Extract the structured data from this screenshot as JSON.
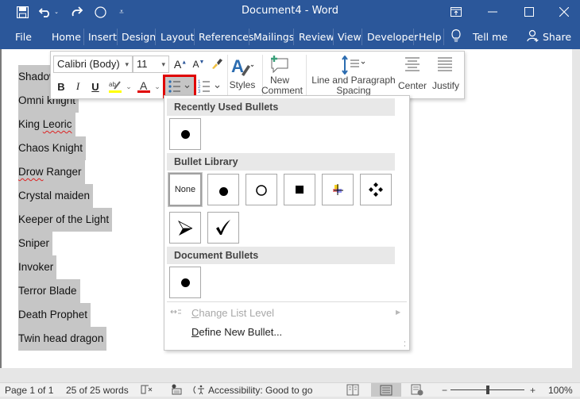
{
  "titlebar": {
    "title": "Document4  -  Word",
    "quick_access": [
      "save-icon",
      "undo-icon",
      "redo-icon",
      "touch-mode-icon",
      "customize-icon"
    ],
    "window_controls": [
      "ribbon-display-icon",
      "minimize-icon",
      "maximize-icon",
      "close-icon"
    ]
  },
  "ribbon_tabs": [
    {
      "label": "File"
    },
    {
      "label": "Home"
    },
    {
      "label": "Insert"
    },
    {
      "label": "Design"
    },
    {
      "label": "Layout"
    },
    {
      "label": "References"
    },
    {
      "label": "Mailings"
    },
    {
      "label": "Review"
    },
    {
      "label": "View"
    },
    {
      "label": "Developer"
    },
    {
      "label": "Help"
    }
  ],
  "tell_me": "Tell me",
  "share": "Share",
  "document": {
    "lines": [
      "Shadow",
      "Omni knight",
      "King Leoric",
      "Chaos Knight",
      "Drow Ranger",
      "Crystal maiden",
      "Keeper of the Light",
      "Sniper",
      "Invoker",
      "Terror Blade",
      "Death Prophet",
      "Twin head dragon"
    ],
    "misspelled": [
      "Leoric",
      "Drow"
    ]
  },
  "mini_toolbar": {
    "font_name": "Calibri (Body)",
    "font_size": "11",
    "bold": "B",
    "italic": "I",
    "underline": "U",
    "font_color_letter": "A",
    "highlight_color": "#ffff00",
    "font_color": "#e00000",
    "styles_label": "Styles",
    "new_comment_label_1": "New",
    "new_comment_label_2": "Comment",
    "spacing_label_1": "Line and Paragraph",
    "spacing_label_2": "Spacing",
    "center_label": "Center",
    "justify_label": "Justify"
  },
  "bullet_dropdown": {
    "recently_used_header": "Recently Used Bullets",
    "library_header": "Bullet Library",
    "none_label": "None",
    "library_items": [
      "none",
      "filled-circle",
      "hollow-circle",
      "filled-square",
      "four-diamond-cross",
      "diamond-cluster",
      "arrowhead",
      "checkmark"
    ],
    "document_header": "Document Bullets",
    "change_level": "Change List Level",
    "define_new": "Define New Bullet..."
  },
  "statusbar": {
    "page": "Page 1 of 1",
    "words": "25 of 25 words",
    "accessibility": "Accessibility: Good to go",
    "zoom": "100%",
    "zoom_percent": 100
  }
}
